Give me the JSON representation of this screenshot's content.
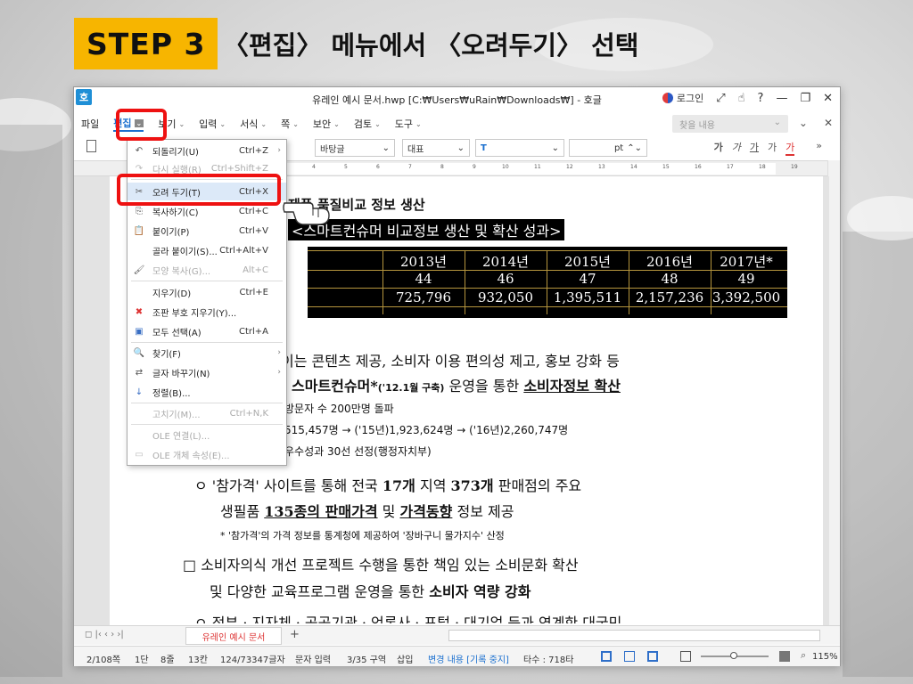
{
  "banner": {
    "step": "STEP 3",
    "title": "〈편집〉 메뉴에서 〈오려두기〉 선택"
  },
  "window": {
    "app_logo": "호",
    "title": "유레인 예시 문서.hwp [C:₩Users₩uRain₩Downloads₩] - 호글",
    "login": "로그인",
    "title_buttons": [
      "⤢",
      "☝",
      "?",
      "—",
      "❐",
      "✕"
    ]
  },
  "menubar": {
    "items": [
      {
        "label": "파일",
        "chev": ""
      },
      {
        "label": "편집",
        "chev": "⌄"
      },
      {
        "label": "보기",
        "chev": "⌄"
      },
      {
        "label": "입력",
        "chev": "⌄"
      },
      {
        "label": "서식",
        "chev": "⌄"
      },
      {
        "label": "쪽",
        "chev": "⌄"
      },
      {
        "label": "보안",
        "chev": "⌄"
      },
      {
        "label": "검토",
        "chev": "⌄"
      },
      {
        "label": "도구",
        "chev": "⌄"
      }
    ],
    "search_placeholder": "찾을 내용",
    "search_chev": "⌄",
    "right_icons": [
      "⌄",
      "✕"
    ]
  },
  "toolbar": {
    "style": "바탕글",
    "font_name": "대표",
    "font_face": "T",
    "size_unit": "pt",
    "font_styles": [
      "가",
      "가",
      "가",
      "가",
      "가"
    ],
    "more": "»"
  },
  "ruler_ticks": [
    "4",
    "5",
    "6",
    "7",
    "8",
    "9",
    "10",
    "11",
    "12",
    "13",
    "14",
    "15",
    "16",
    "17",
    "18",
    "19"
  ],
  "edit_menu": {
    "items": [
      {
        "icon": "↶",
        "label": "되돌리기(U)",
        "shortcut": "Ctrl+Z",
        "arrow": "›",
        "disabled": false
      },
      {
        "icon": "↷",
        "label": "다시 실행(R)",
        "shortcut": "Ctrl+Shift+Z",
        "arrow": "",
        "disabled": true
      },
      {
        "icon": "✂",
        "label": "오려 두기(T)",
        "shortcut": "Ctrl+X",
        "arrow": "",
        "disabled": false
      },
      {
        "icon": "⎘",
        "label": "복사하기(C)",
        "shortcut": "Ctrl+C",
        "arrow": "",
        "disabled": false
      },
      {
        "icon": "📋",
        "label": "붙이기(P)",
        "shortcut": "Ctrl+V",
        "arrow": "",
        "disabled": false
      },
      {
        "icon": "",
        "label": "골라 붙이기(S)...",
        "shortcut": "Ctrl+Alt+V",
        "arrow": "",
        "disabled": false
      },
      {
        "icon": "🖌",
        "label": "모양 복사(G)...",
        "shortcut": "Alt+C",
        "arrow": "",
        "disabled": true
      },
      {
        "icon": "",
        "label": "지우기(D)",
        "shortcut": "Ctrl+E",
        "arrow": "",
        "disabled": false
      },
      {
        "icon": "✖",
        "label": "조판 부호 지우기(Y)...",
        "shortcut": "",
        "arrow": "",
        "disabled": false
      },
      {
        "icon": "▣",
        "label": "모두 선택(A)",
        "shortcut": "Ctrl+A",
        "arrow": "",
        "disabled": false
      },
      {
        "icon": "🔍",
        "label": "찾기(F)",
        "shortcut": "",
        "arrow": "›",
        "disabled": false
      },
      {
        "icon": "⇄",
        "label": "글자 바꾸기(N)",
        "shortcut": "",
        "arrow": "›",
        "disabled": false
      },
      {
        "icon": "↓",
        "label": "정렬(B)...",
        "shortcut": "",
        "arrow": "",
        "disabled": false
      },
      {
        "icon": "",
        "label": "고치기(M)...",
        "shortcut": "Ctrl+N,K",
        "arrow": "",
        "disabled": true
      },
      {
        "icon": "",
        "label": "OLE 연결(L)...",
        "shortcut": "",
        "arrow": "",
        "disabled": true
      },
      {
        "icon": "▭",
        "label": "OLE 개체 속성(E)...",
        "shortcut": "",
        "arrow": "",
        "disabled": true
      }
    ]
  },
  "document": {
    "line1": "제품 품질비교 정보 생산",
    "line2": "<스마트컨슈머 비교정보 생산 및 확산 성과>",
    "table_headers": [
      "2013년",
      "2014년",
      "2015년",
      "2016년",
      "2017년*"
    ],
    "table_row1": [
      "44",
      "46",
      "47",
      "48",
      "49"
    ],
    "table_row2": [
      "725,796",
      "932,050",
      "1,395,511",
      "2,157,236",
      "3,392,500"
    ],
    "p1": "이는 콘텐츠 제공, 소비자 이용 편의성 제고, 홍보 강화 등",
    "p2_a": "스마트컨슈머*",
    "p2_b": "('12.1월 구축)",
    "p2_c": "운영을 통한",
    "p2_d": "소비자정보 확산",
    "p3": "방문자 수 200만명 돌파",
    "p4": "515,457명 → ('15년)1,923,624명 → ('16년)2,260,747명",
    "p5": "우수성과 30선 선정(행정자치부)",
    "p6_a": "ㅇ '참가격' 사이트를 통해 전국",
    "p6_b": "17개",
    "p6_c": "지역",
    "p6_d": "373개",
    "p6_e": "판매점의 주요",
    "p7_a": "생필품",
    "p7_b": "135종의 판매가격",
    "p7_c": "및",
    "p7_d": "가격동향",
    "p7_e": "정보 제공",
    "p8": "* '참가격'의 가격 정보를 통계청에 제공하여 '장바구니 물가지수' 산정",
    "p9": "□ 소비자의식 개선 프로젝트 수행을 통한 책임 있는 소비문화 확산",
    "p10_a": "및 다양한 교육프로그램 운영을 통한",
    "p10_b": "소비자 역량 강화",
    "p11": "ㅇ 정부 · 지자체 · 공공기관 · 언론사 · 포털 · 대기업 등과 연계한 대국민"
  },
  "tabbar": {
    "nav": "◻  |‹  ‹  ›  ›|",
    "doc_tab": "유레인 예시 문서",
    "add": "+"
  },
  "statusbar": {
    "page": "2/108쪽",
    "column": "1단",
    "line": "8줄",
    "char": "13칸",
    "chars": "124/73347글자",
    "mode": "문자 입력",
    "section": "3/35 구역",
    "insert": "삽입",
    "track": "변경 내용 [기록 중지]",
    "typing": "타수 : 718타",
    "zoom": "115%"
  },
  "colors": {
    "banner": "#f7b500",
    "highlight": "#ee1111",
    "accent": "#1a6fcf"
  }
}
